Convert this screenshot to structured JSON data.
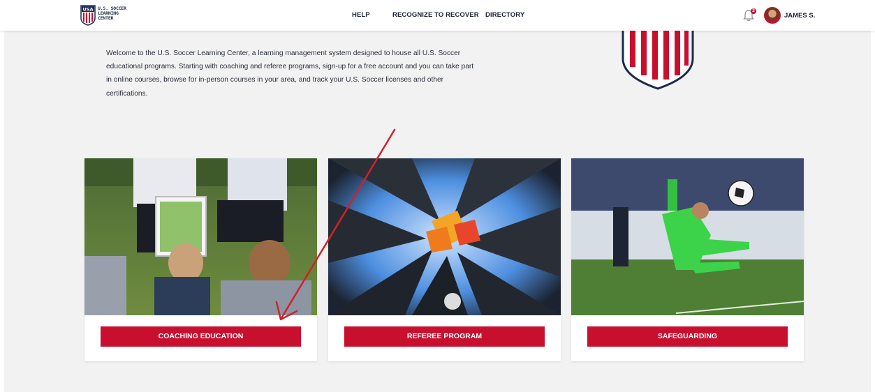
{
  "header": {
    "logo_lines": [
      "U.S. SOCCER",
      "LEARNING",
      "CENTER"
    ],
    "nav": [
      {
        "label": "HELP"
      },
      {
        "label": "RECOGNIZE TO RECOVER"
      },
      {
        "label": "DIRECTORY"
      }
    ],
    "notification_count": "2",
    "user_name": "JAMES S."
  },
  "welcome_text": "Welcome to the U.S. Soccer Learning Center, a learning management system designed to house all U.S. Soccer educational programs. Starting with coaching and referee programs, sign-up for a free account and you can take part in online courses, browse for in-person courses in your area, and track your U.S. Soccer licenses and other certifications.",
  "cards": [
    {
      "button_label": "COACHING EDUCATION",
      "image": "coaching-photo"
    },
    {
      "button_label": "REFEREE PROGRAM",
      "image": "referee-photo"
    },
    {
      "button_label": "SAFEGUARDING",
      "image": "goalkeeper-photo"
    }
  ],
  "colors": {
    "brand_red": "#c8102e",
    "brand_navy": "#1c2a4d",
    "page_background": "#f2f2f2",
    "annotation_arrow": "#d3202a"
  }
}
